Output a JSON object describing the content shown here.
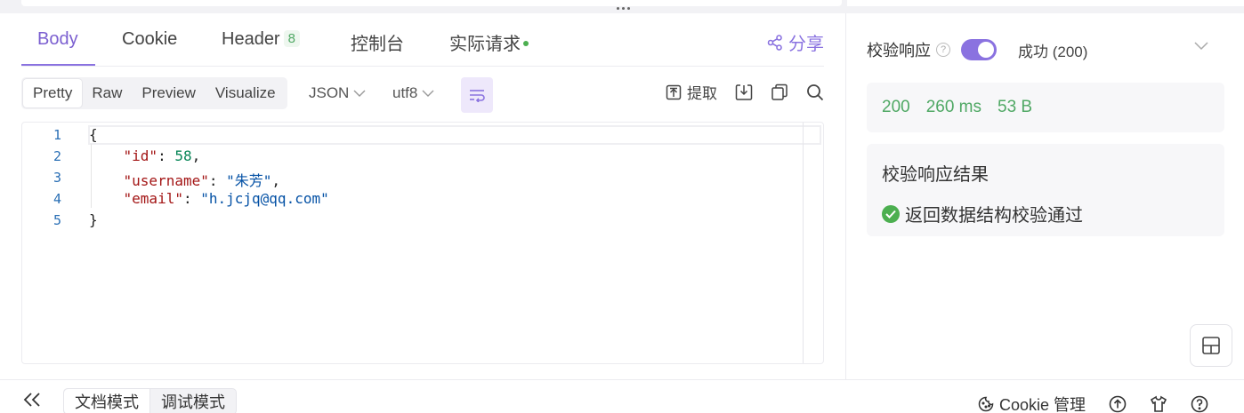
{
  "tabs": [
    {
      "label": "Body"
    },
    {
      "label": "Cookie"
    },
    {
      "label": "Header",
      "badge": "8"
    },
    {
      "label": "控制台"
    },
    {
      "label": "实际请求"
    }
  ],
  "share_label": "分享",
  "view_modes": [
    "Pretty",
    "Raw",
    "Preview",
    "Visualize"
  ],
  "format_select": "JSON",
  "encoding_select": "utf8",
  "extract_label": "提取",
  "code": {
    "line_numbers": [
      "1",
      "2",
      "3",
      "4",
      "5"
    ],
    "open_brace": "{",
    "close_brace": "}",
    "id_key": "\"id\"",
    "id_value": "58",
    "username_key": "\"username\"",
    "username_value": "\"朱芳\"",
    "email_key": "\"email\"",
    "email_value": "\"h.jcjq@qq.com\""
  },
  "validation": {
    "label": "校验响应",
    "help": "?",
    "enabled": true,
    "status": "成功 (200)"
  },
  "metrics": {
    "status_code": "200",
    "time": "260 ms",
    "size": "53 B"
  },
  "result": {
    "title": "校验响应结果",
    "message": "返回数据结构校验通过"
  },
  "bottom": {
    "doc_mode": "文档模式",
    "debug_mode": "调试模式",
    "cookie_manage": "Cookie 管理"
  },
  "colors": {
    "accent": "#8a72e0",
    "success": "#4fa864"
  }
}
